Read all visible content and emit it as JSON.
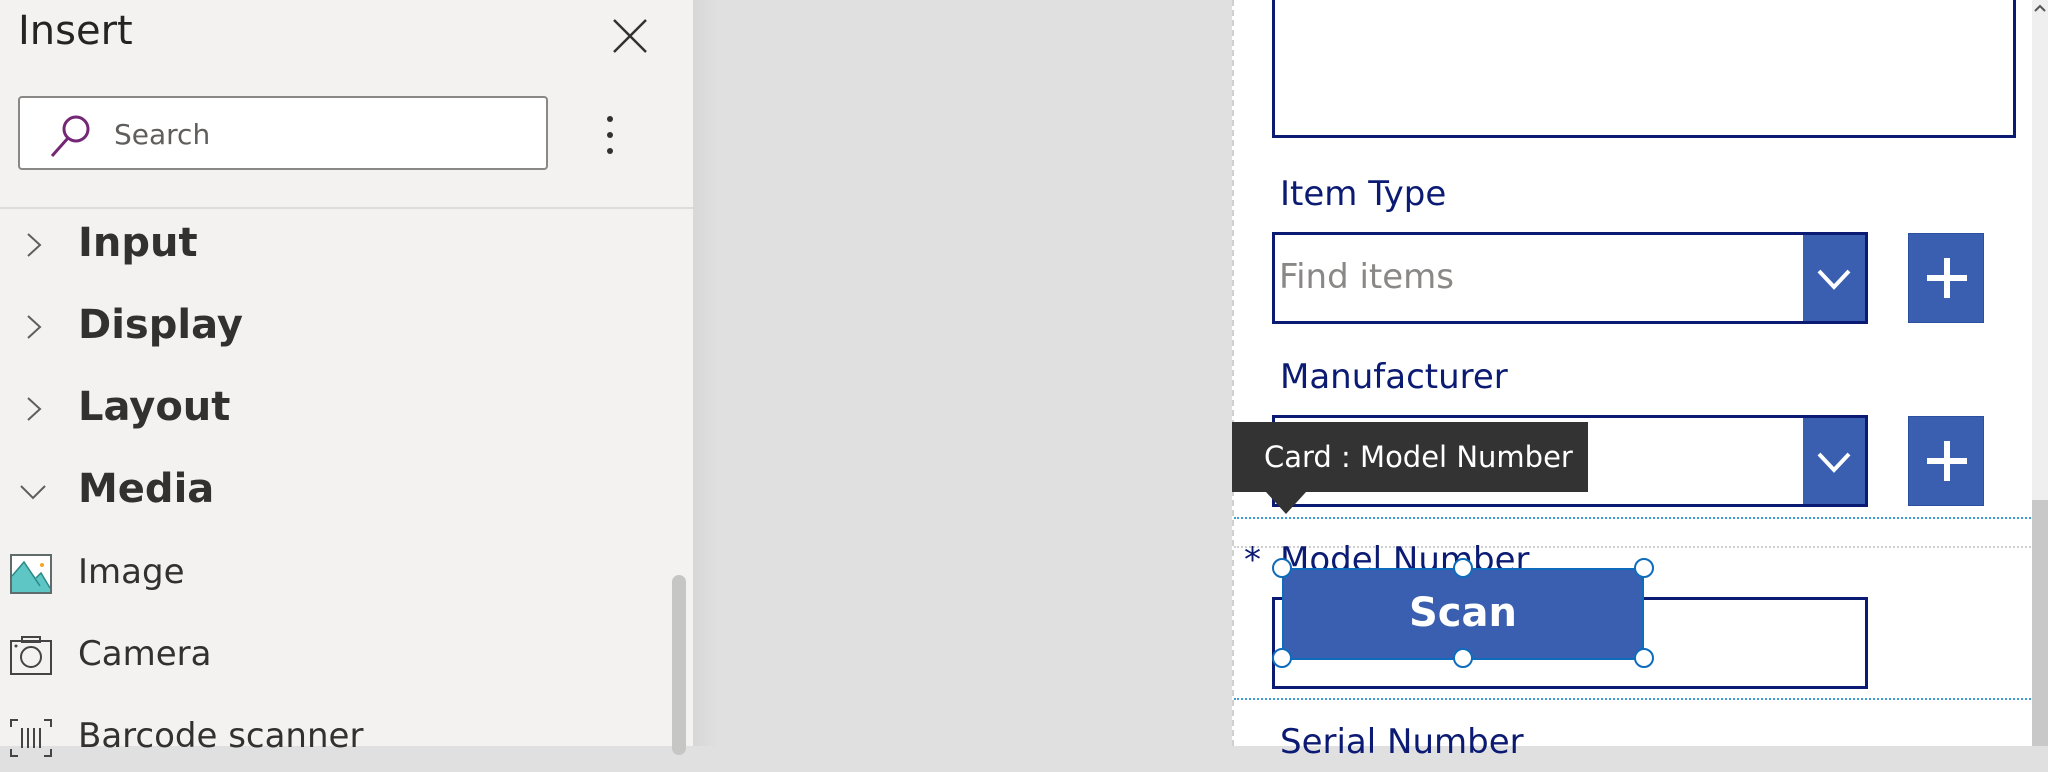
{
  "insert_panel": {
    "title": "Insert",
    "search": {
      "placeholder": "Search",
      "value": ""
    },
    "categories": [
      {
        "label": "Input",
        "expanded": false
      },
      {
        "label": "Display",
        "expanded": false
      },
      {
        "label": "Layout",
        "expanded": false
      },
      {
        "label": "Media",
        "expanded": true
      }
    ],
    "media_items": [
      {
        "label": "Image",
        "icon": "image-icon"
      },
      {
        "label": "Camera",
        "icon": "camera-icon"
      },
      {
        "label": "Barcode scanner",
        "icon": "barcode-icon"
      }
    ]
  },
  "form": {
    "fields": [
      {
        "label": "Item Type",
        "placeholder": "Find items"
      },
      {
        "label": "Manufacturer",
        "placeholder": ""
      },
      {
        "label": "Model Number",
        "required_marker": "*"
      },
      {
        "label": "Serial Number"
      }
    ],
    "scan_button_label": "Scan",
    "tooltip": "Card : Model Number"
  },
  "colors": {
    "accent": "#3a5fb0",
    "label_navy": "#0b1a72",
    "selection": "#0f6cbd",
    "search_icon": "#742774"
  }
}
